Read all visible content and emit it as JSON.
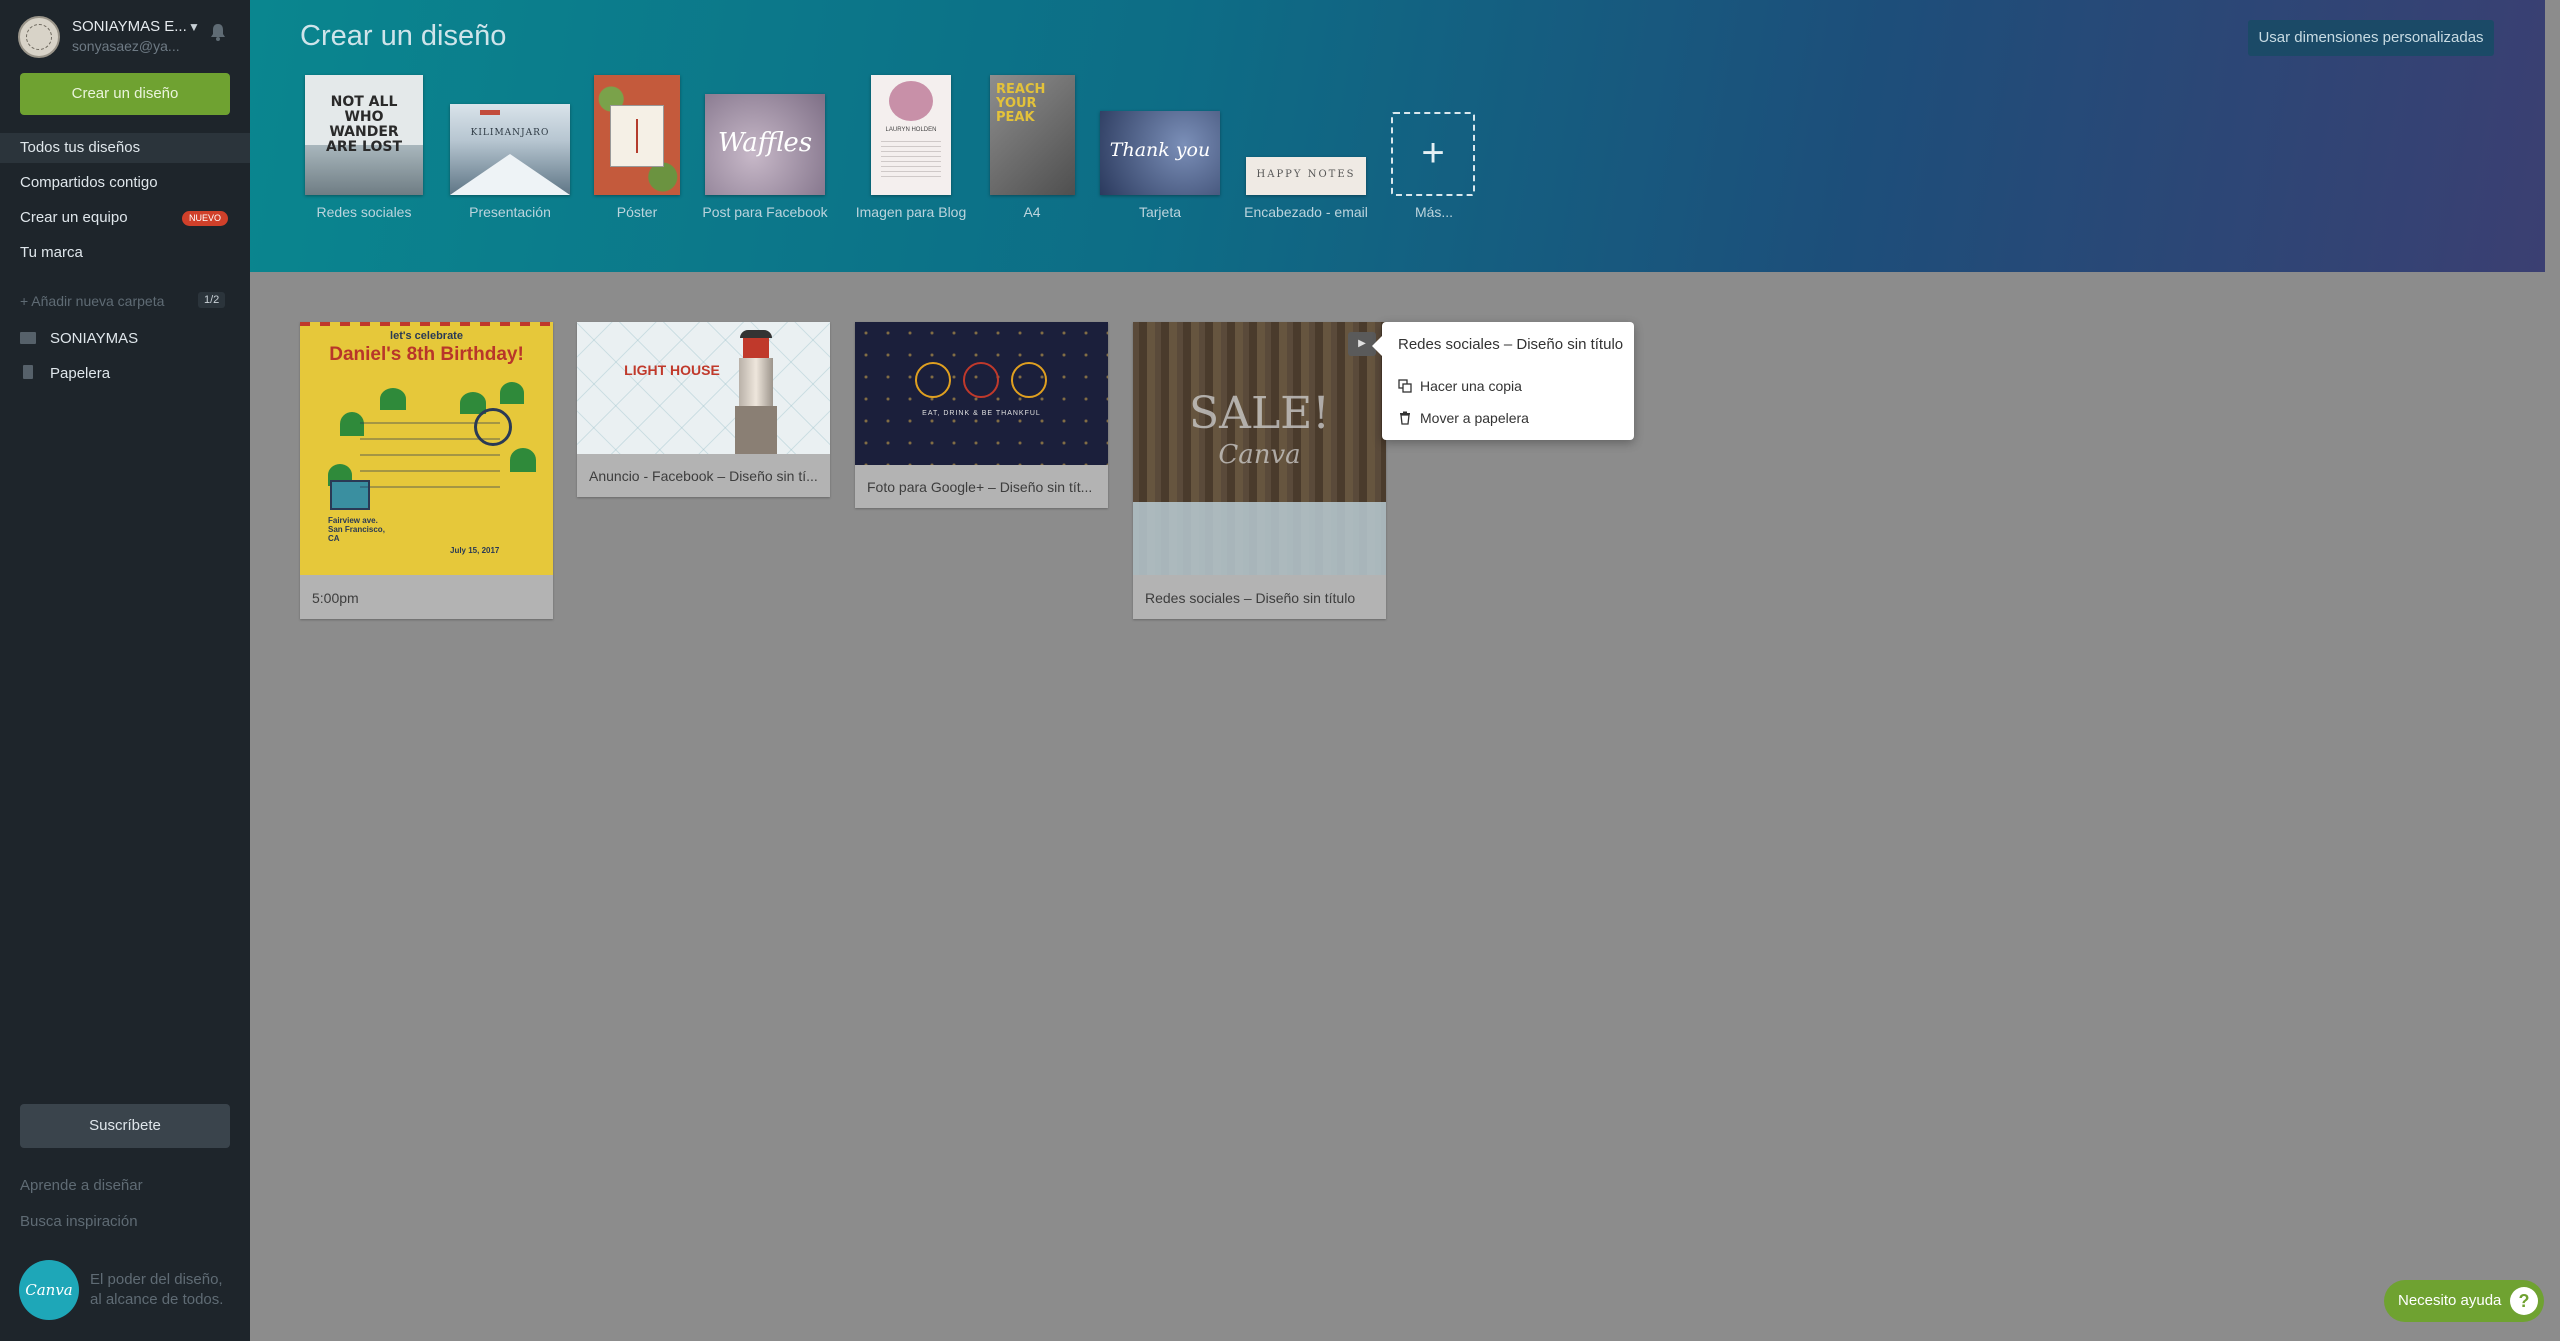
{
  "sidebar": {
    "user_name": "SONIAYMAS E...",
    "user_email": "sonyasaez@ya...",
    "create_button": "Crear un diseño",
    "nav": [
      {
        "label": "Todos tus diseños"
      },
      {
        "label": "Compartidos contigo"
      },
      {
        "label": "Crear un equipo",
        "badge": "NUEVO"
      },
      {
        "label": "Tu marca"
      }
    ],
    "add_folder": "+ Añadir nueva carpeta",
    "folder_count": "1/2",
    "folders": [
      {
        "label": "SONIAYMAS"
      },
      {
        "label": "Papelera"
      }
    ],
    "subscribe": "Suscríbete",
    "learn": "Aprende a diseñar",
    "inspiration": "Busca inspiración",
    "logo": "Canva",
    "tagline_1": "El poder del diseño,",
    "tagline_2": "al alcance de todos."
  },
  "header": {
    "title": "Crear un diseño",
    "custom_dimensions": "Usar dimensiones personalizadas",
    "types": [
      {
        "label": "Redes sociales",
        "thumb_text": "NOT ALL WHO WANDER ARE LOST"
      },
      {
        "label": "Presentación",
        "thumb_text": "KILIMANJARO"
      },
      {
        "label": "Póster",
        "thumb_text": ""
      },
      {
        "label": "Post para Facebook",
        "thumb_text": "Waffles"
      },
      {
        "label": "Imagen para Blog",
        "thumb_text": "LAURYN HOLDEN"
      },
      {
        "label": "A4",
        "thumb_text": "REACH YOUR PEAK"
      },
      {
        "label": "Tarjeta",
        "thumb_text": "Thank you"
      },
      {
        "label": "Encabezado - email",
        "thumb_text": "HAPPY NOTES"
      },
      {
        "label": "Más...",
        "thumb_text": "+"
      }
    ]
  },
  "designs": [
    {
      "label": "5:00pm",
      "thumb_title": "Daniel's 8th Birthday!",
      "thumb_sub": "let's celebrate",
      "thumb_date": "July 15, 2017",
      "thumb_addr": "Fairview ave. San Francisco, CA"
    },
    {
      "label": "Anuncio - Facebook – Diseño sin tí...",
      "thumb_title": "LIGHT HOUSE"
    },
    {
      "label": "Foto para Google+ – Diseño sin tít...",
      "thumb_title": "EAT, DRINK & BE THANKFUL"
    },
    {
      "label": "Redes sociales – Diseño sin título",
      "thumb_title": "SALE!",
      "thumb_sub": "Canva"
    }
  ],
  "context_menu": {
    "title": "Redes sociales – Diseño sin título",
    "copy": "Hacer una copia",
    "trash": "Mover a papelera"
  },
  "help": {
    "label": "Necesito ayuda",
    "icon": "?"
  }
}
